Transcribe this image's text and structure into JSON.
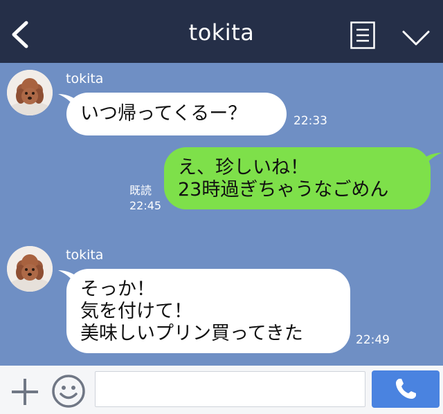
{
  "header": {
    "title": "tokita"
  },
  "messages": [
    {
      "sender": "tokita",
      "lines": [
        "いつ帰ってくるー？"
      ],
      "time": "22:33"
    },
    {
      "read_label": "既読",
      "time": "22:45",
      "lines": [
        "え、珍しいね！",
        "23時過ぎちゃうなごめん"
      ]
    },
    {
      "sender": "tokita",
      "lines": [
        "そっか！",
        "気を付けて！",
        "美味しいプリン買ってきた"
      ],
      "time": "22:49"
    }
  ],
  "colors": {
    "header_bg": "#252f48",
    "chat_bg": "#6f8fc4",
    "outgoing_bubble": "#7ee04a",
    "incoming_bubble": "#ffffff",
    "call_button": "#4a83e0"
  },
  "icons": {
    "back": "chevron-left-icon",
    "menu": "list-icon",
    "collapse": "chevron-down-icon",
    "add": "plus-icon",
    "emoji": "smiley-icon",
    "call": "phone-icon"
  }
}
